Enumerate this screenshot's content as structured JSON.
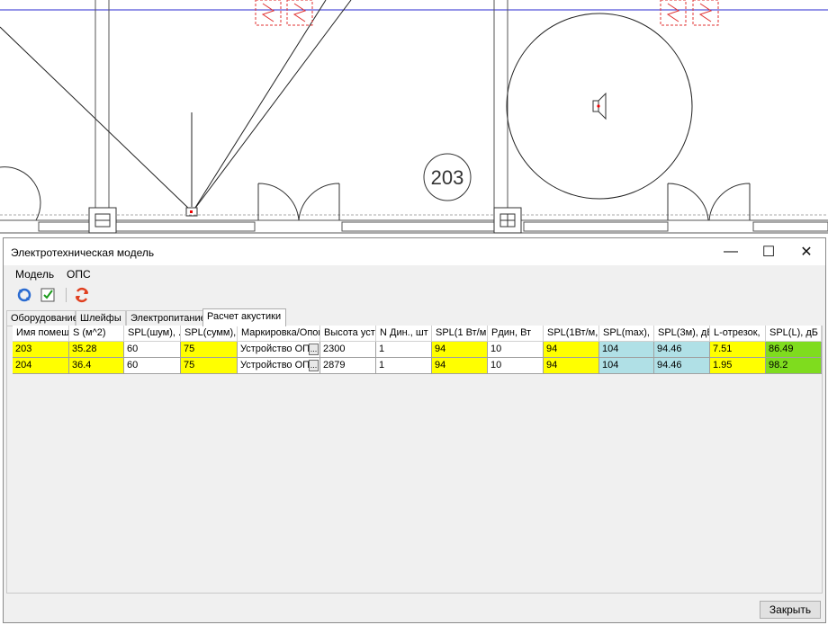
{
  "cad": {
    "room_number": "203"
  },
  "window": {
    "title": "Электротехническая модель",
    "controls": {
      "minimize": "—",
      "maximize": "☐",
      "close": "✕"
    }
  },
  "menu": [
    "Модель",
    "ОПС"
  ],
  "toolbar": {
    "icons": [
      "refresh-icon",
      "checkbox-icon",
      "recalculate-icon"
    ]
  },
  "tabs": [
    "Оборудование",
    "Шлейфы",
    "Электропитание",
    "Расчет акустики"
  ],
  "active_tab": "Расчет акустики",
  "table": {
    "columns": [
      "Имя помещ",
      "S (м^2)",
      "SPL(шум), .",
      "SPL(сумм),",
      "Маркировка/Опов",
      "Высота уст",
      "N Дин., шт",
      "SPL(1 Вт/м",
      "Pдин, Вт",
      "SPL(1Вт/м,",
      "SPL(max), ,",
      "SPL(3м), дБ",
      "L-отрезок,",
      "SPL(L), дБ"
    ],
    "rows": [
      [
        "203",
        "35.28",
        "60",
        "75",
        "Устройство ОПС",
        "2300",
        "1",
        "94",
        "10",
        "94",
        "104",
        "94.46",
        "7.51",
        "86.49"
      ],
      [
        "204",
        "36.4",
        "60",
        "75",
        "Устройство ОПС",
        "2879",
        "1",
        "94",
        "10",
        "94",
        "104",
        "94.46",
        "1.95",
        "98.2"
      ]
    ],
    "cell_button": "..."
  },
  "colors": {
    "yellow": "#ffff00",
    "blue": "#b0e0e6",
    "green": "#7fdc1e",
    "white": "#ffffff"
  },
  "close_button": "Закрыть"
}
